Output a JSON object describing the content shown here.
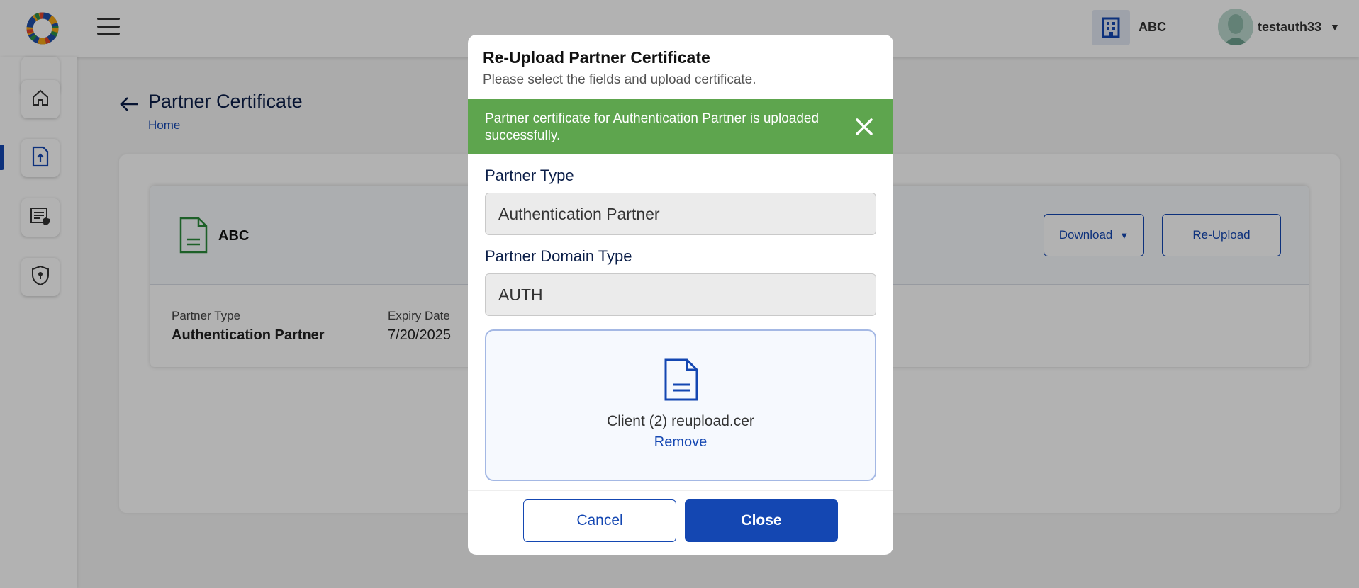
{
  "header": {
    "org_name": "ABC",
    "username": "testauth33",
    "org_icon": "building-icon",
    "menu_icon": "hamburger-menu-icon"
  },
  "sidebar": {
    "items": [
      {
        "icon": "home-icon",
        "active": false
      },
      {
        "icon": "upload-certificate-icon",
        "active": true
      },
      {
        "icon": "policy-icon",
        "active": false
      },
      {
        "icon": "shield-icon",
        "active": false
      }
    ]
  },
  "page": {
    "title": "Partner Certificate",
    "breadcrumb": "Home"
  },
  "card": {
    "name": "ABC",
    "download_label": "Download",
    "reupload_label": "Re-Upload",
    "partner_type_label": "Partner Type",
    "partner_type_value": "Authentication Partner",
    "expiry_label": "Expiry Date",
    "expiry_value": "7/20/2025"
  },
  "modal": {
    "title": "Re-Upload Partner Certificate",
    "subtitle": "Please select the fields and upload certificate.",
    "alert_text": "Partner certificate for Authentication Partner is uploaded successfully.",
    "partner_type_label": "Partner Type",
    "partner_type_value": "Authentication Partner",
    "domain_type_label": "Partner Domain Type",
    "domain_type_value": "AUTH",
    "file_name": "Client (2) reupload.cer",
    "remove_label": "Remove",
    "cancel_label": "Cancel",
    "close_label": "Close"
  },
  "colors": {
    "primary": "#1447b2",
    "success": "#5ea54e",
    "title": "#0b1e48"
  }
}
